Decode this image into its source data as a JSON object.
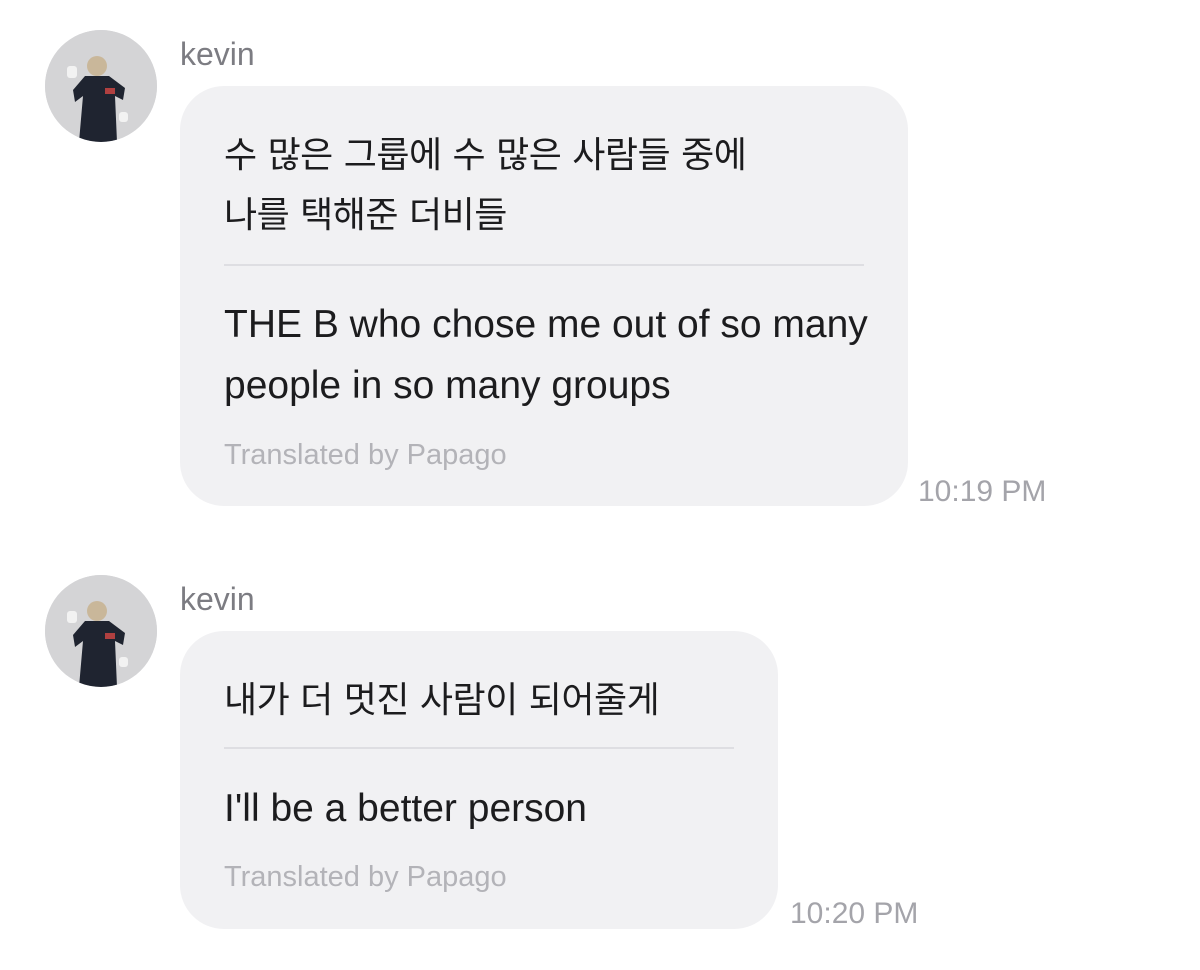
{
  "messages": [
    {
      "sender": "kevin",
      "original": "수 많은 그룹에 수 많은 사람들 중에\n나를 택해준 더비들",
      "translated": "THE B who chose me out of so many people in so many groups",
      "credit": "Translated by Papago",
      "time": "10:19 PM"
    },
    {
      "sender": "kevin",
      "original": "내가 더 멋진 사람이 되어줄게",
      "translated": "I'll be a better person",
      "credit": "Translated by Papago",
      "time": "10:20 PM"
    }
  ],
  "icons": {
    "avatar": "profile-photo-person-icon"
  },
  "colors": {
    "bubble": "#f1f1f3",
    "sender": "#7c7c82",
    "text": "#1c1c1e",
    "credit": "#b3b3b8",
    "time": "#a4a4aa",
    "divider": "#dedee2"
  }
}
